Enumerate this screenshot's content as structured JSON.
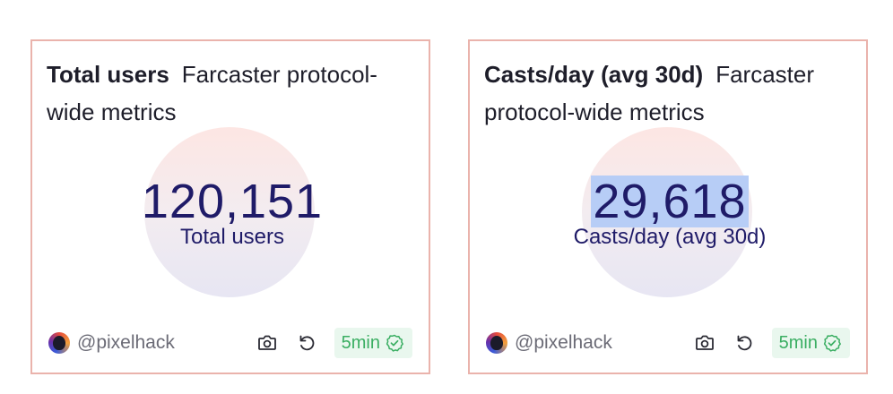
{
  "cards": [
    {
      "title": "Total users",
      "subtitle": "Farcaster protocol-wide metrics",
      "value": "120,151",
      "value_label": "Total users",
      "author": "@pixelhack",
      "freshness": "5min"
    },
    {
      "title": "Casts/day (avg 30d)",
      "subtitle": "Farcaster protocol-wide metrics",
      "value": "29,618",
      "value_label": "Casts/day (avg 30d)",
      "author": "@pixelhack",
      "freshness": "5min",
      "value_selected": true
    }
  ],
  "icons": {
    "author_avatar": "avatar",
    "snapshot": "camera-icon",
    "refresh": "refresh-icon",
    "freshness_status": "check-circle-icon"
  },
  "colors": {
    "card_border": "#eab3ac",
    "metric_text": "#1f1b68",
    "fresh_text": "#3aae62",
    "fresh_bg": "#e9f7ee",
    "selection": "#b7cdf6"
  }
}
